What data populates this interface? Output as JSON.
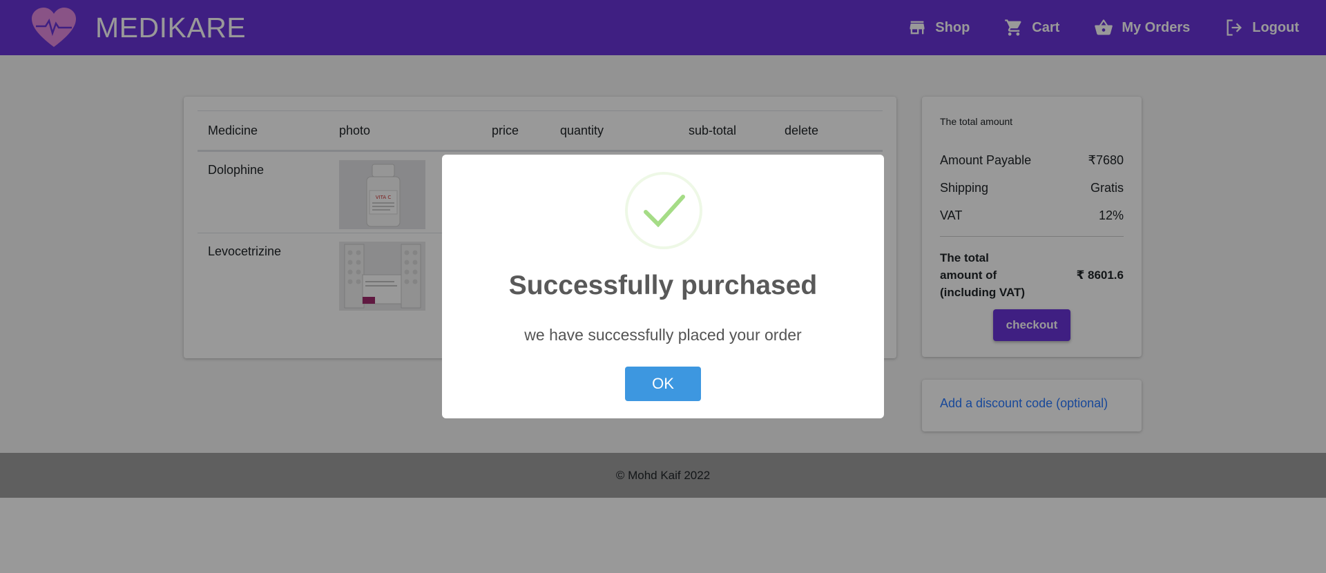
{
  "header": {
    "brand": "MEDIKARE",
    "nav": [
      {
        "label": "Shop",
        "icon": "store-icon"
      },
      {
        "label": "Cart",
        "icon": "cart-icon"
      },
      {
        "label": "My Orders",
        "icon": "basket-icon"
      },
      {
        "label": "Logout",
        "icon": "logout-icon"
      }
    ],
    "color": "#6a35d9"
  },
  "cart": {
    "columns": [
      "Medicine",
      "photo",
      "price",
      "quantity",
      "sub-total",
      "delete"
    ],
    "rows": [
      {
        "name": "Dolophine",
        "photo_icon": "pill-bottle-image"
      },
      {
        "name": "Levocetrizine",
        "photo_icon": "blister-pack-image"
      }
    ]
  },
  "summary": {
    "title": "The total amount",
    "amount_payable_label": "Amount Payable",
    "amount_payable_value": "₹7680",
    "shipping_label": "Shipping",
    "shipping_value": "Gratis",
    "vat_label": "VAT",
    "vat_value": "12%",
    "total_label": "The total amount of (including VAT)",
    "total_value": "₹ 8601.6",
    "checkout_label": "checkout"
  },
  "discount": {
    "link_label": "Add a discount code (optional)"
  },
  "footer": {
    "text": "© Mohd Kaif 2022"
  },
  "modal": {
    "title": "Successfully purchased",
    "text": "we have successfully placed your order",
    "ok_label": "OK"
  }
}
